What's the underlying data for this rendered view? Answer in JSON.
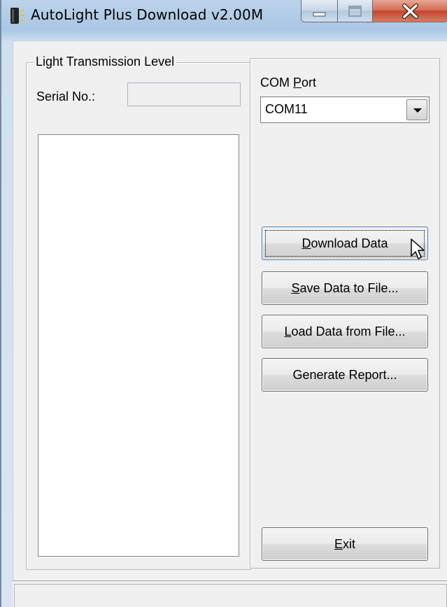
{
  "window": {
    "title": "AutoLight Plus Download v2.00M",
    "icon": "app-light-icon",
    "controls": {
      "minimize": "minimize-icon",
      "maximize": "maximize-icon",
      "close": "close-icon"
    }
  },
  "group": {
    "legend": "Light Transmission Level",
    "serial_label": "Serial No.:",
    "serial_value": "",
    "list_items": []
  },
  "com": {
    "label_pre": "COM ",
    "label_accel": "P",
    "label_post": "ort",
    "selected": "COM11"
  },
  "buttons": {
    "download": {
      "accel": "D",
      "rest": "ownload Data"
    },
    "save": {
      "accel": "S",
      "rest": "ave Data to File..."
    },
    "load": {
      "accel": "L",
      "rest": "oad Data from File..."
    },
    "report": {
      "text": "Generate Report..."
    },
    "exit": {
      "accel": "E",
      "rest": "xit"
    }
  },
  "status": {
    "text": ""
  },
  "colors": {
    "close_button": "#c4442c",
    "focus_border": "#3c7fb1",
    "face": "#f0f0f0"
  }
}
